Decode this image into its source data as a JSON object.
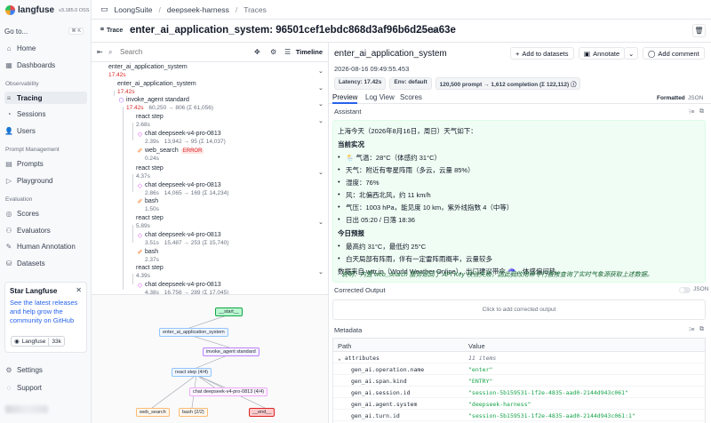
{
  "brand": {
    "name": "langfuse",
    "version": "v3.185.0 OSS"
  },
  "sidebar": {
    "goto_label": "Go to...",
    "goto_shortcut": "⌘ K",
    "items_top": [
      {
        "label": "Home",
        "icon": "home-icon"
      },
      {
        "label": "Dashboards",
        "icon": "dashboard-icon"
      }
    ],
    "observability_label": "Observability",
    "observability_items": [
      {
        "label": "Tracing",
        "icon": "tracing-icon",
        "active": true
      },
      {
        "label": "Sessions",
        "icon": "sessions-icon"
      },
      {
        "label": "Users",
        "icon": "users-icon"
      }
    ],
    "prompt_label": "Prompt Management",
    "prompt_items": [
      {
        "label": "Prompts",
        "icon": "prompts-icon"
      },
      {
        "label": "Playground",
        "icon": "playground-icon"
      }
    ],
    "evaluation_label": "Evaluation",
    "evaluation_items": [
      {
        "label": "Scores",
        "icon": "scores-icon"
      },
      {
        "label": "Evaluators",
        "icon": "evaluators-icon"
      },
      {
        "label": "Human Annotation",
        "icon": "annotation-icon"
      },
      {
        "label": "Datasets",
        "icon": "datasets-icon"
      }
    ],
    "star_card": {
      "title": "Star Langfuse",
      "text": "See the latest releases and help grow the community on GitHub",
      "github_label": "Langfuse",
      "github_count": "33k"
    },
    "bottom_items": [
      {
        "label": "Settings",
        "icon": "settings-icon"
      },
      {
        "label": "Support",
        "icon": "support-icon"
      }
    ]
  },
  "breadcrumb": {
    "org": "LoongSuite",
    "project": "deepseek-harness",
    "page": "Traces"
  },
  "trace": {
    "badge": "Trace",
    "title": "enter_ai_application_system: 96501cef1ebdc868d3af96b6d25ea63e"
  },
  "tree_toolbar": {
    "search_placeholder": "Search",
    "timeline_label": "Timeline"
  },
  "tree": [
    {
      "name": "enter_ai_application_system",
      "latency": "17.42s",
      "metrics": ""
    },
    {
      "name": "enter_ai_application_system",
      "latency": "17.42s",
      "metrics": ""
    },
    {
      "name": "invoke_agent standard",
      "latency": "17.42s",
      "metrics": "60,250 → 806 (Σ 61,056)"
    },
    {
      "name": "react step",
      "latency": "2.68s",
      "metrics": ""
    },
    {
      "name": "chat deepseek-v4-pro-0813",
      "latency": "2.39s",
      "metrics": "13,942 → 95 (Σ 14,037)"
    },
    {
      "name": "web_search",
      "latency": "0.24s",
      "metrics": "",
      "badge": "ERROR"
    },
    {
      "name": "react step",
      "latency": "4.37s",
      "metrics": ""
    },
    {
      "name": "chat deepseek-v4-pro-0813",
      "latency": "2.86s",
      "metrics": "14,065 → 169 (Σ 14,234)"
    },
    {
      "name": "bash",
      "latency": "1.50s",
      "metrics": ""
    },
    {
      "name": "react step",
      "latency": "5.89s",
      "metrics": ""
    },
    {
      "name": "chat deepseek-v4-pro-0813",
      "latency": "3.51s",
      "metrics": "15,487 → 253 (Σ 15,740)"
    },
    {
      "name": "bash",
      "latency": "2.37s",
      "metrics": ""
    },
    {
      "name": "react step",
      "latency": "4.39s",
      "metrics": ""
    },
    {
      "name": "chat deepseek-v4-pro-0813",
      "latency": "4.38s",
      "metrics": "16,756 → 289 (Σ 17,045)"
    }
  ],
  "graph": {
    "start": "__start__",
    "app": "enter_ai_application_system",
    "agent": "invoke_agent standard",
    "react": "react step (4/4)",
    "chat": "chat deepseek-v4-pro-0813 (4/4)",
    "web": "web_search",
    "bash": "bash (2/2)",
    "end": "__end__"
  },
  "detail": {
    "title": "enter_ai_application_system",
    "add_datasets": "Add to datasets",
    "annotate": "Annotate",
    "add_comment": "Add comment",
    "datetime": "2026-08-16 09:49:55.453",
    "pills": [
      "Latency: 17.42s",
      "Env: default",
      "120,500 prompt → 1,612 completion (Σ 122,112)"
    ],
    "tabs": [
      "Preview",
      "Log View",
      "Scores"
    ],
    "format_formatted": "Formatted",
    "format_json": "JSON",
    "assistant_label": "Assistant",
    "assistant_lines": {
      "intro": "上海今天（2026年8月16日，周日）天气如下：",
      "current_h": "当前实况",
      "temp": "🌦️ 气温：28°C（体感约 31°C）",
      "weather": "天气：附近有零星阵雨（多云，云量 85%）",
      "humidity": "湿度：76%",
      "wind": "风：北偏西北风，约 11 km/h",
      "pressure": "气压：1003 hPa，能见度 10 km，紫外线指数 4（中等）",
      "sun": "日出 05:20 / 日落 18:36",
      "forecast_h": "今日预报",
      "high_low": "最高约 31°C，最低约 25°C",
      "shower": "白天局部有阵雨，伴有一定雷阵雨概率，云量较多",
      "source": "数据来自 wttr.in（World Weather Online），出门建议带伞 ☂️，体感偏闷热。",
      "note": "说明：内置 web_search 服务返回了 API Key 校验失败，因此我改用命令行直接查询了实时气象源获取上述数据。"
    },
    "corrected_label": "Corrected Output",
    "corrected_json": "JSON",
    "corrected_placeholder": "Click to add corrected output",
    "metadata_label": "Metadata",
    "meta_head": {
      "path": "Path",
      "value": "Value"
    },
    "meta_rows": [
      {
        "key": "attributes",
        "value": "11 items",
        "count": true,
        "expand": true
      },
      {
        "key": "gen_ai.operation.name",
        "value": "\"enter\""
      },
      {
        "key": "gen_ai.span.kind",
        "value": "\"ENTRY\""
      },
      {
        "key": "gen_ai.session.id",
        "value": "\"session-5b159531-1f2e-4835-aad0-2144d943c061\""
      },
      {
        "key": "gen_ai.agent.system",
        "value": "\"deepseek-harness\""
      },
      {
        "key": "gen_ai.turn.id",
        "value": "\"session-5b159531-1f2e-4835-aad0-2144d943c061:1\""
      }
    ]
  },
  "colors": {
    "accent": "#2563eb",
    "error": "#dc2626",
    "assistant_bg": "#f0fdf4",
    "json_value": "#16a34a"
  }
}
